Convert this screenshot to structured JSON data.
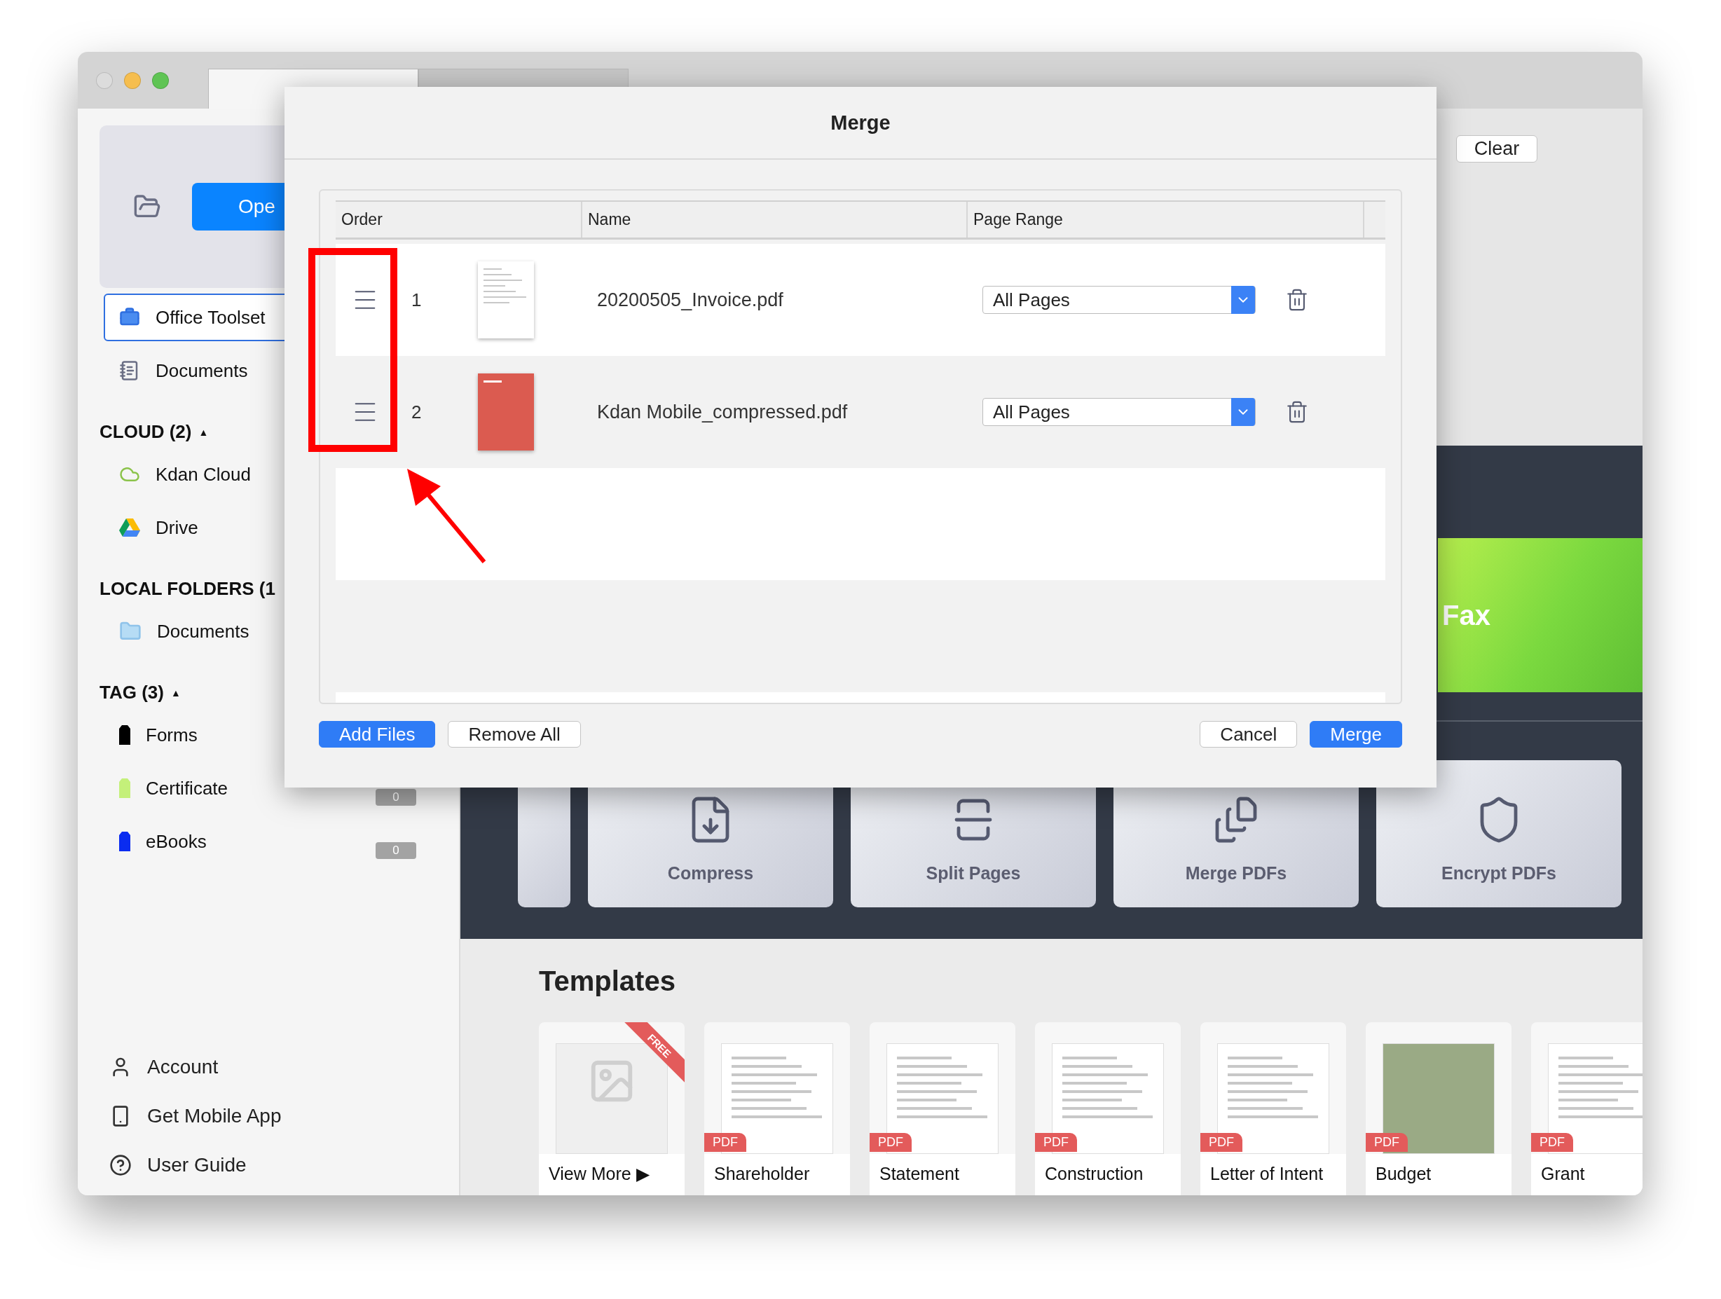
{
  "sidebar": {
    "open_button": "Ope",
    "top_items": [
      {
        "label": "Office Toolset",
        "selected": true
      },
      {
        "label": "Documents",
        "selected": false
      }
    ],
    "sections": [
      {
        "title": "CLOUD (2)",
        "caret": "▲",
        "items": [
          {
            "label": "Kdan Cloud",
            "selected": false
          },
          {
            "label": "Drive",
            "selected": false
          }
        ]
      },
      {
        "title": "LOCAL FOLDERS (1",
        "items": [
          {
            "label": "Documents",
            "selected": false
          }
        ]
      },
      {
        "title": "TAG (3)",
        "caret": "▲",
        "items": [
          {
            "label": "Forms",
            "color": "#000000",
            "selected": false
          },
          {
            "label": "Certificate",
            "color": "#c4f07a",
            "count": "0",
            "selected": false
          },
          {
            "label": "eBooks",
            "color": "#0a2cf0",
            "count": "0",
            "selected": false
          }
        ]
      }
    ],
    "bottom_items": [
      "Account",
      "Get Mobile App",
      "User Guide"
    ]
  },
  "main": {
    "clear_button": "Clear",
    "banner": {
      "title": "Fax"
    },
    "tools": [
      "Compress",
      "Split Pages",
      "Merge PDFs",
      "Encrypt PDFs"
    ],
    "templates": {
      "title": "Templates",
      "cards": [
        {
          "kind": "view-more",
          "caption": "View More ▶",
          "ribbon": "FREE"
        },
        {
          "kind": "pdf",
          "badge": "PDF",
          "caption": "Shareholder"
        },
        {
          "kind": "pdf",
          "badge": "PDF",
          "caption": "Statement"
        },
        {
          "kind": "pdf",
          "badge": "PDF",
          "caption": "Construction"
        },
        {
          "kind": "pdf",
          "badge": "PDF",
          "caption": "Letter of Intent"
        },
        {
          "kind": "budget",
          "badge": "PDF",
          "caption": "Budget"
        },
        {
          "kind": "pdf",
          "badge": "PDF",
          "caption": "Grant"
        }
      ]
    }
  },
  "dialog": {
    "title": "Merge",
    "columns": [
      "Order",
      "Name",
      "Page Range"
    ],
    "rows": [
      {
        "order": "1",
        "kind": "invoice",
        "name": "20200505_Invoice.pdf",
        "page_range": "All Pages"
      },
      {
        "order": "2",
        "kind": "cover",
        "name": "Kdan Mobile_compressed.pdf",
        "page_range": "All Pages"
      }
    ],
    "buttons_left": [
      {
        "label": "Add Files",
        "primary": true
      },
      {
        "label": "Remove All",
        "primary": false
      }
    ],
    "buttons_right": [
      {
        "label": "Cancel",
        "primary": false
      },
      {
        "label": "Merge",
        "primary": true
      }
    ]
  }
}
